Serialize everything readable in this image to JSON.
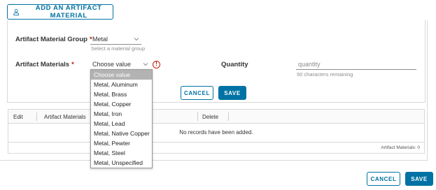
{
  "add_button": {
    "label": "ADD AN ARTIFACT MATERIAL",
    "icon": "user-icon"
  },
  "form": {
    "group_label": "Artifact Material Group",
    "group_value": "Metal",
    "group_helper": "Select a material group",
    "materials_label": "Artifact Materials",
    "materials_value": "Choose value",
    "required_mark": "*",
    "error_icon": "!",
    "quantity_label": "Quantity",
    "quantity_placeholder": "quantity",
    "quantity_helper": "50 characters remaining",
    "cancel_label": "CANCEL",
    "save_label": "SAVE"
  },
  "dropdown": {
    "options": [
      "Choose value",
      "Metal, Aluminum",
      "Metal, Brass",
      "Metal, Copper",
      "Metal, Iron",
      "Metal, Lead",
      "Metal, Native Copper",
      "Metal, Pewter",
      "Metal, Steel",
      "Metal, Unspecified"
    ],
    "selected_index": 0
  },
  "grid": {
    "columns": [
      "Edit",
      "Artifact Materials",
      "Delete"
    ],
    "empty_message": "No records have been added.",
    "footer": "Artifact Materials: 0"
  },
  "footer_actions": {
    "cancel_label": "CANCEL",
    "save_label": "SAVE"
  },
  "colors": {
    "accent": "#0072a3",
    "required": "#c21d00",
    "selected_option": "#b3b3b3"
  }
}
